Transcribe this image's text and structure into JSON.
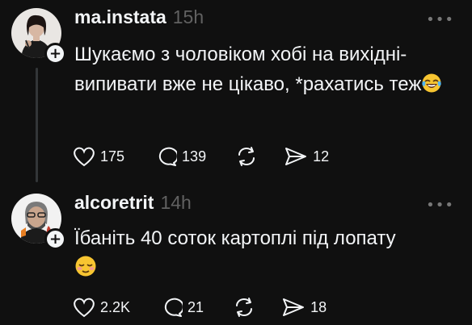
{
  "posts": [
    {
      "username": "ma.instata",
      "time": "15h",
      "text": "Шукаємо з чоловіком хобі на вихідні- випивати вже не цікаво, *рахатись теж",
      "emoji": "tears-of-joy-emoji",
      "likes": "175",
      "replies": "139",
      "shares": "12",
      "avatar_icon": "woman-portrait-icon"
    },
    {
      "username": "alcoretrit",
      "time": "14h",
      "text": "Їбаніть 40 соток картоплі під лопату",
      "emoji": "relieved-face-emoji",
      "likes": "2.2K",
      "replies": "21",
      "shares": "18",
      "avatar_icon": "man-portrait-icon"
    }
  ],
  "colors": {
    "background": "#101010",
    "text": "#f3f5f7",
    "muted": "#616161",
    "thread_line": "#333638"
  }
}
